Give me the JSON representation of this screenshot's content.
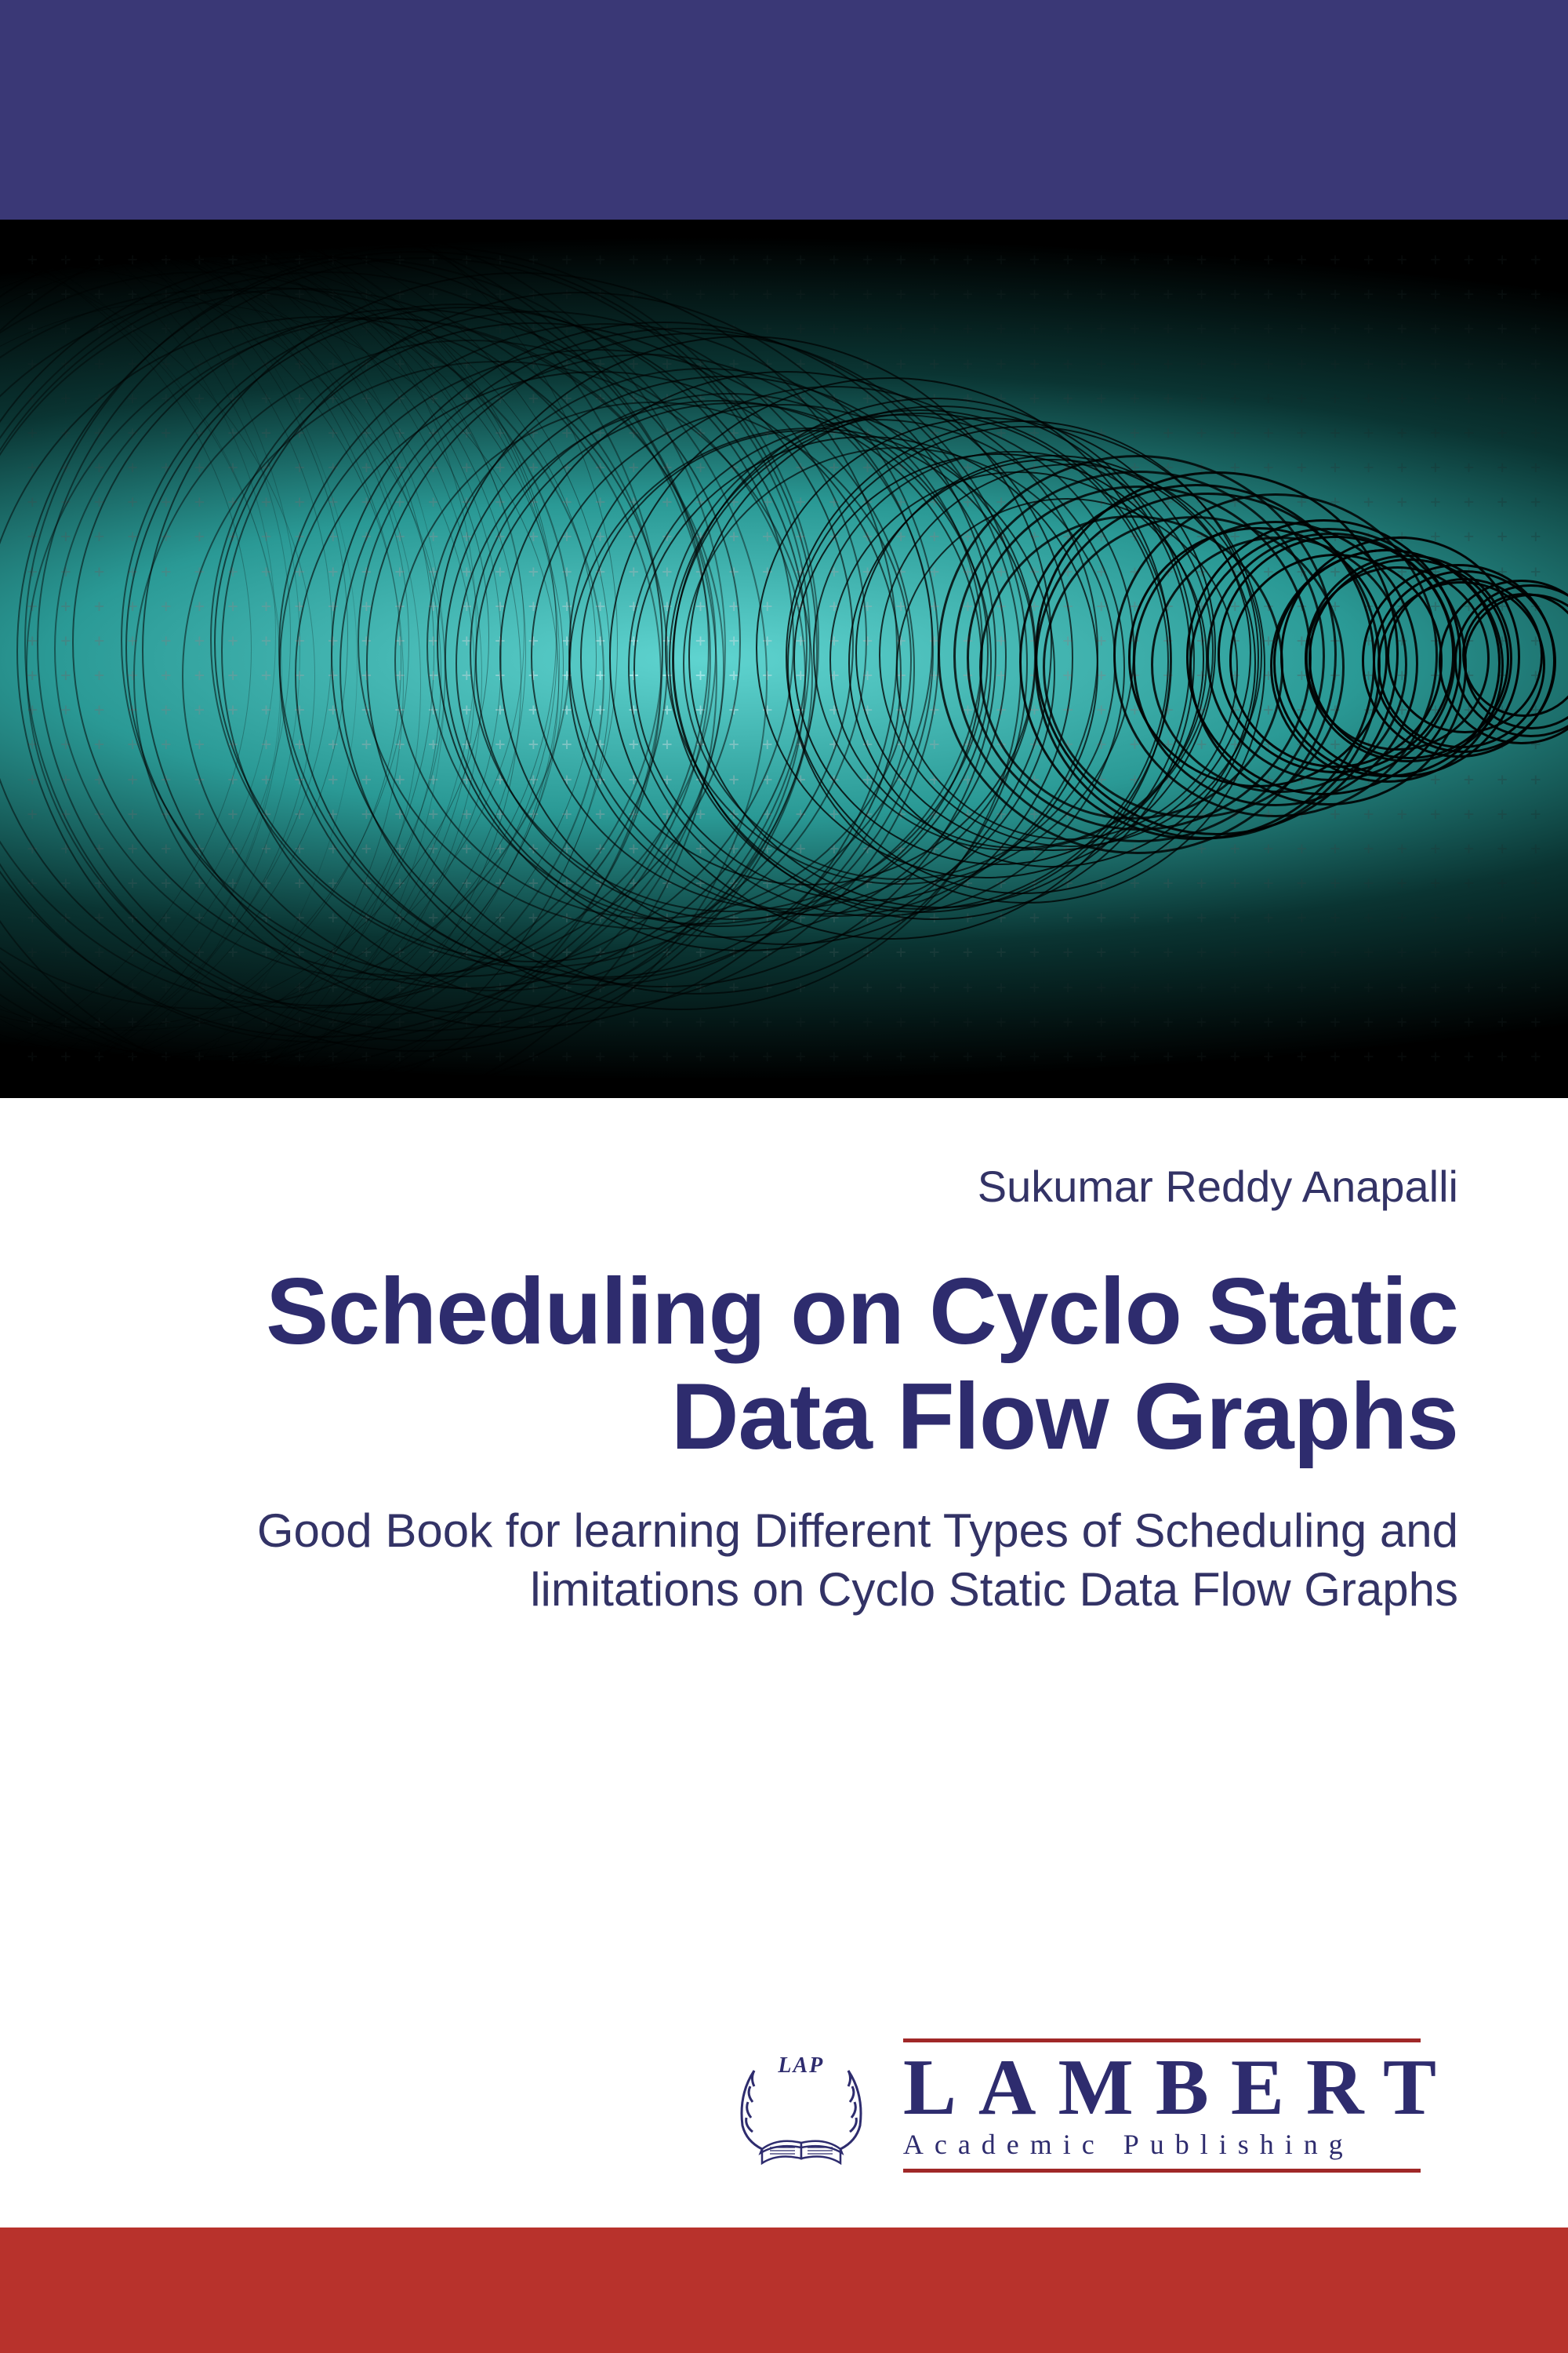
{
  "author": "Sukumar Reddy Anapalli",
  "title": "Scheduling on Cyclo Static Data Flow Graphs",
  "subtitle": "Good Book for learning Different Types of Scheduling and limitations on Cyclo Static Data Flow Graphs",
  "publisher": {
    "emblem_text": "LAP",
    "name": "LAMBERT",
    "sub": "Academic Publishing"
  },
  "colors": {
    "top_bar": "#3a3876",
    "bottom_bar": "#b8322c",
    "text": "#2e2c6e",
    "accent": "#a02828"
  }
}
